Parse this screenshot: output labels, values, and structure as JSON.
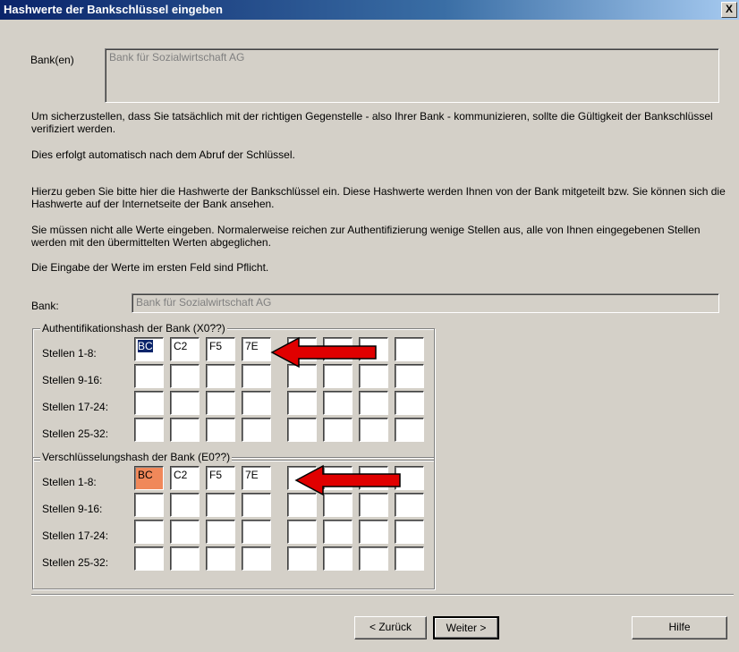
{
  "window": {
    "title": "Hashwerte der Bankschlüssel eingeben",
    "close_label": "X"
  },
  "banks": {
    "label": "Bank(en)",
    "value": "Bank für Sozialwirtschaft AG"
  },
  "text": {
    "p1": "Um sicherzustellen, dass Sie tatsächlich mit der richtigen Gegenstelle - also Ihrer Bank - kommunizieren, sollte die Gültigkeit der Bankschlüssel verifiziert werden.",
    "p2": "Dies erfolgt automatisch nach dem Abruf der Schlüssel.",
    "p3": "Hierzu geben Sie bitte hier die Hashwerte der Bankschlüssel ein. Diese Hashwerte werden Ihnen von der Bank mitgeteilt bzw. Sie können sich die Hashwerte auf der Internetseite der Bank ansehen.",
    "p4": "Sie müssen nicht alle Werte eingeben. Normalerweise reichen zur Authentifizierung wenige Stellen aus, alle von Ihnen eingegebenen Stellen werden mit den übermittelten Werten abgeglichen.",
    "p5": "Die Eingabe der Werte im ersten Feld sind Pflicht."
  },
  "bank": {
    "label": "Bank:",
    "value": "Bank für Sozialwirtschaft AG"
  },
  "auth_group": {
    "title": "Authentifikationshash der Bank (X0??)",
    "rows": [
      "Stellen 1-8:",
      "Stellen 9-16:",
      "Stellen 17-24:",
      "Stellen 25-32:"
    ],
    "values": [
      "BC",
      "C2",
      "F5",
      "7E"
    ]
  },
  "enc_group": {
    "title": "Verschlüsselungshash der Bank (E0??)",
    "rows": [
      "Stellen 1-8:",
      "Stellen 9-16:",
      "Stellen 17-24:",
      "Stellen 25-32:"
    ],
    "values": [
      "BC",
      "C2",
      "F5",
      "7E"
    ]
  },
  "buttons": {
    "back": "< Zurück",
    "next": "Weiter >",
    "help": "Hilfe"
  },
  "colors": {
    "arrow": "#e00000",
    "highlight": "#f0885a",
    "selection": "#0a246a"
  }
}
